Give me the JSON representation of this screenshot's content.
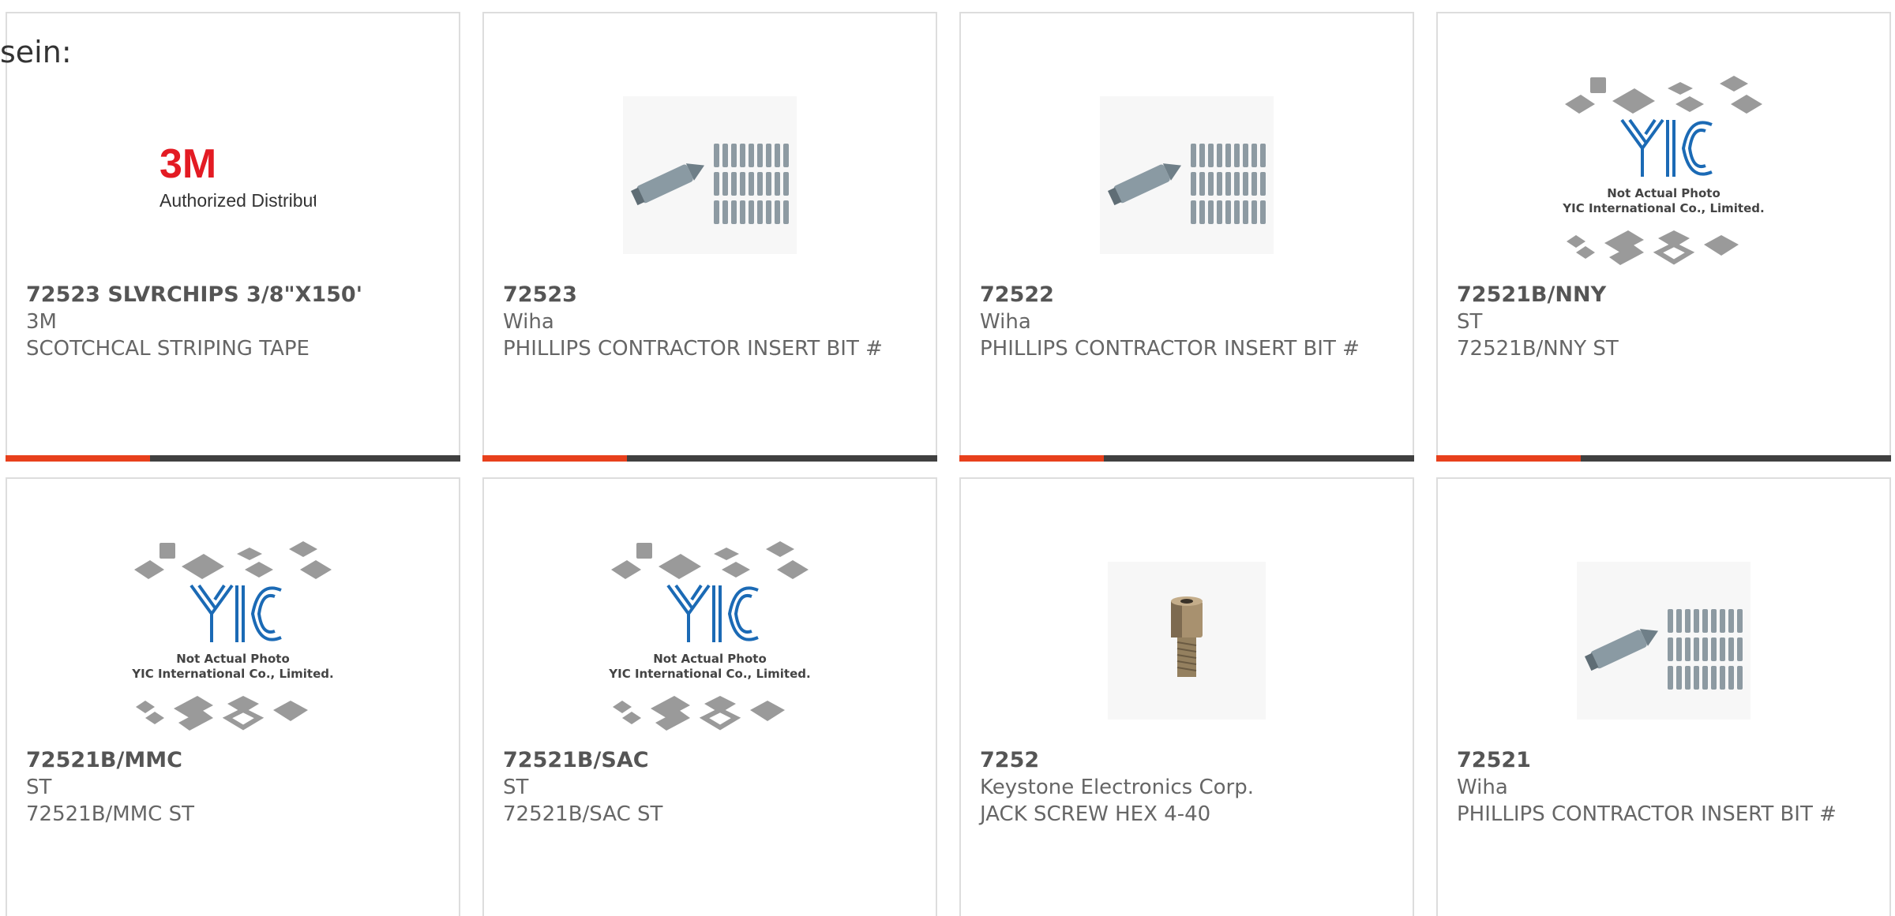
{
  "intro": {
    "text": "sein:"
  },
  "colors": {
    "accent": "#e8401c",
    "bar": "#404040",
    "card_border": "#dddddd",
    "text": "#666666"
  },
  "products": [
    {
      "part_number": "72523 SLVRCHIPS 3/8\"X150'",
      "manufacturer": "3M",
      "description": "SCOTCHCAL STRIPING TAPE",
      "image": "3m-authorized-distributor-logo",
      "logo_brand": "3M",
      "logo_caption": "Authorized Distributor"
    },
    {
      "part_number": "72523",
      "manufacturer": "Wiha",
      "description": "PHILLIPS CONTRACTOR INSERT BIT #",
      "image": "screwdriver-bits-photo"
    },
    {
      "part_number": "72522",
      "manufacturer": "Wiha",
      "description": "PHILLIPS CONTRACTOR INSERT BIT #",
      "image": "screwdriver-bits-photo"
    },
    {
      "part_number": "72521B/NNY",
      "manufacturer": "ST",
      "description": "72521B/NNY ST",
      "image": "not-actual-photo-placeholder",
      "placeholder_line1": "Not Actual Photo",
      "placeholder_line2": "YIC International Co., Limited."
    },
    {
      "part_number": "72521B/MMC",
      "manufacturer": "ST",
      "description": "72521B/MMC ST",
      "image": "not-actual-photo-placeholder",
      "placeholder_line1": "Not Actual Photo",
      "placeholder_line2": "YIC International Co., Limited."
    },
    {
      "part_number": "72521B/SAC",
      "manufacturer": "ST",
      "description": "72521B/SAC ST",
      "image": "not-actual-photo-placeholder",
      "placeholder_line1": "Not Actual Photo",
      "placeholder_line2": "YIC International Co., Limited."
    },
    {
      "part_number": "7252",
      "manufacturer": "Keystone Electronics Corp.",
      "description": "JACK SCREW HEX 4-40",
      "image": "jack-screw-photo"
    },
    {
      "part_number": "72521",
      "manufacturer": "Wiha",
      "description": "PHILLIPS CONTRACTOR INSERT BIT #",
      "image": "screwdriver-bits-photo"
    }
  ]
}
